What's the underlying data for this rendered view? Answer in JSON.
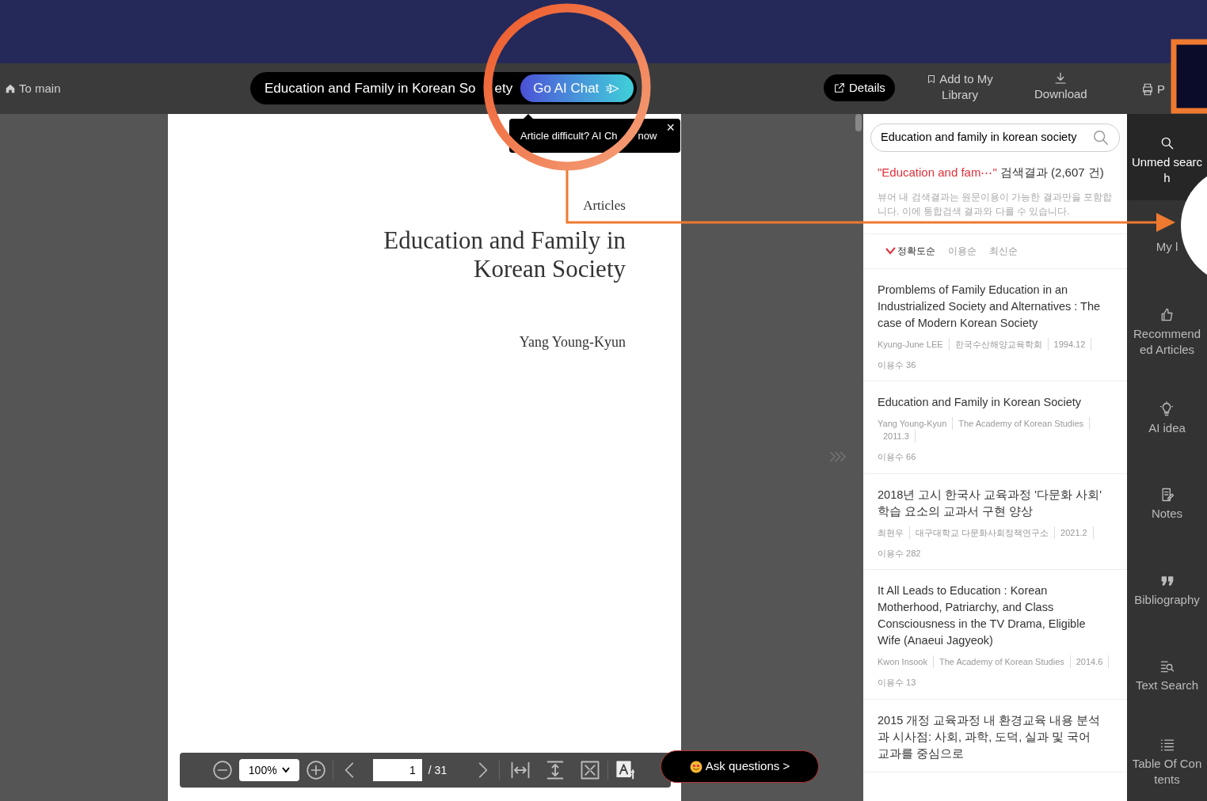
{
  "topbar": {
    "home": "To main",
    "doc_title": [
      "Education and Family in Korean So",
      "ety"
    ],
    "ai_button": "Go AI Chat",
    "details": "Details",
    "add_library": "Add to My Library",
    "download": "Download",
    "print": "P"
  },
  "tooltip": {
    "text": [
      "Article difficult? AI Ch",
      "now"
    ],
    "close": "×"
  },
  "document": {
    "section": "Articles",
    "title": "Education and Family in Korean Society",
    "author": "Yang Young-Kyun"
  },
  "viewer_toolbar": {
    "zoom": "100%",
    "page": "1",
    "total": "/ 31"
  },
  "ask_button": "Ask questions >",
  "search": {
    "value": "Education and family in korean society",
    "query": "\"Education and fam⋯\"",
    "result_count": " 검색결과 (2,607 건)",
    "note": "뷰어 내 검색결과는 원문이용이 가능한 결과만을 포함합니다. 이에 통합검색 결과와 다를 수 있습니다.",
    "sort": [
      {
        "label": "정확도순",
        "selected": true
      },
      {
        "label": "이용순",
        "selected": false
      },
      {
        "label": "최신순",
        "selected": false
      }
    ],
    "results": [
      {
        "title": "Promblems of Family Education in an Industrialized Society and Alternatives : The case of Modern Korean Society",
        "meta": [
          "Kyung-June LEE",
          "한국수산해양교육학회",
          "1994.12"
        ],
        "uses": "이용수 36"
      },
      {
        "title": "Education and Family in Korean Society",
        "meta": [
          "Yang Young-Kyun",
          "The Academy of Korean Studies",
          "2011.3"
        ],
        "uses": "이용수 66"
      },
      {
        "title": "2018년 고시 한국사 교육과정 '다문화 사회' 학습 요소의 교과서 구현 양상",
        "meta": [
          "최현우",
          "대구대학교 다문화사회정책연구소",
          "2021.2"
        ],
        "uses": "이용수 282"
      },
      {
        "title": "It All Leads to Education : Korean Motherhood, Patriarchy, and Class Consciousness in the TV Drama, Eligible Wife (Anaeui Jagyeok)",
        "meta": [
          "Kwon Insook",
          "The Academy of Korean Studies",
          "2014.6"
        ],
        "uses": "이용수 13"
      },
      {
        "title": "2015 개정 교육과정 내 환경교육 내용 분석과 시사점: 사회, 과학, 도덕, 실과 및 국어 교과를 중심으로"
      }
    ]
  },
  "sidebar": [
    {
      "kind": "search",
      "label": "Unmed search",
      "selected": true
    },
    {
      "kind": "library",
      "label": "My l",
      "selected": false
    },
    {
      "kind": "thumb",
      "label": "Recommended Articles",
      "selected": false
    },
    {
      "kind": "bulb",
      "label": "AI idea",
      "selected": false
    },
    {
      "kind": "note",
      "label": "Notes",
      "selected": false
    },
    {
      "kind": "quote",
      "label": "Bibliography",
      "selected": false
    },
    {
      "kind": "textsearch",
      "label": "Text Search",
      "selected": false
    },
    {
      "kind": "list",
      "label": "Table Of Contents",
      "selected": false
    }
  ]
}
